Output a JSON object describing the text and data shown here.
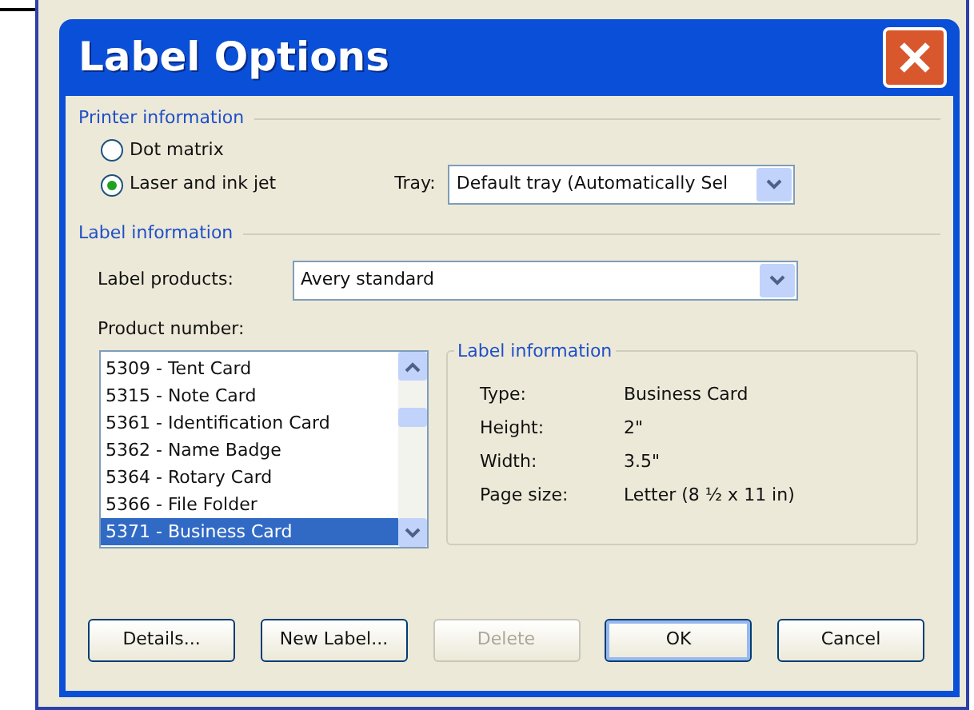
{
  "window": {
    "title": "Label Options"
  },
  "printer_information": {
    "legend": "Printer information",
    "options": [
      {
        "label": "Dot matrix",
        "selected": false
      },
      {
        "label": "Laser and ink jet",
        "selected": true
      }
    ],
    "tray": {
      "label": "Tray:",
      "value": "Default tray (Automatically Sel"
    }
  },
  "label_information": {
    "legend": "Label information",
    "label_products": {
      "label": "Label products:",
      "value": "Avery standard"
    },
    "product_number": {
      "label": "Product number:",
      "items": [
        {
          "text": "5309 - Tent Card",
          "selected": false
        },
        {
          "text": "5315 - Note Card",
          "selected": false
        },
        {
          "text": "5361 - Identification Card",
          "selected": false
        },
        {
          "text": "5362 - Name Badge",
          "selected": false
        },
        {
          "text": "5364 - Rotary Card",
          "selected": false
        },
        {
          "text": "5366 - File Folder",
          "selected": false
        },
        {
          "text": "5371 - Business Card",
          "selected": true
        }
      ]
    },
    "details": {
      "legend": "Label information",
      "rows": [
        {
          "name": "Type:",
          "value": "Business Card"
        },
        {
          "name": "Height:",
          "value": "2\""
        },
        {
          "name": "Width:",
          "value": "3.5\""
        },
        {
          "name": "Page size:",
          "value": "Letter (8 ½ x 11 in)"
        }
      ]
    }
  },
  "buttons": [
    {
      "label": "Details...",
      "disabled": false,
      "default": false
    },
    {
      "label": "New Label...",
      "disabled": false,
      "default": false
    },
    {
      "label": "Delete",
      "disabled": true,
      "default": false
    },
    {
      "label": "OK",
      "disabled": false,
      "default": true
    },
    {
      "label": "Cancel",
      "disabled": false,
      "default": false
    }
  ]
}
